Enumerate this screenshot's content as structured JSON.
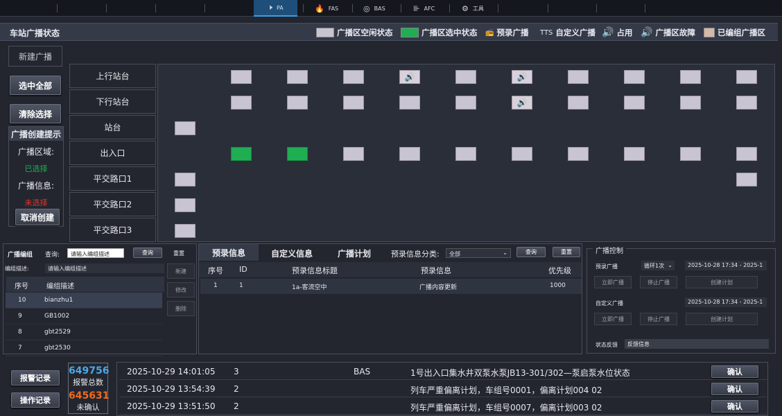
{
  "topnav": {
    "items": [
      {
        "label": "PA",
        "icon": "speaker-icon"
      },
      {
        "label": "FAS",
        "icon": "fire-icon"
      },
      {
        "label": "BAS",
        "icon": "fan-icon"
      },
      {
        "label": "AFC",
        "icon": "gate-icon"
      },
      {
        "label": "工具",
        "icon": "tools-icon"
      }
    ],
    "active": "PA"
  },
  "header": {
    "title": "车站广播状态",
    "legend": [
      "广播区空闲状态",
      "广播区选中状态",
      "预录广播",
      "TTS",
      "自定义广播",
      "占用",
      "广播区故障",
      "已编组广播区"
    ]
  },
  "colors": {
    "idle": "#c9c4d2",
    "selected": "#1fae52",
    "fault": "#e0352b",
    "occupied": "#f0d43a"
  },
  "left": {
    "new_broadcast": "新建广播",
    "select_all": "选中全部",
    "clear_selection": "清除选择",
    "hint_title": "广播创建提示",
    "area_label": "广播区域:",
    "area_status": "已选择",
    "info_label": "广播信息:",
    "info_status": "未选择",
    "cancel_create": "取消创建"
  },
  "rows": [
    "上行站台",
    "下行站台",
    "站台",
    "出入口",
    "平交路口1",
    "平交路口2",
    "平交路口3"
  ],
  "grid": {
    "layout": [
      [
        "e",
        "i",
        "i",
        "i",
        "f",
        "i",
        "f",
        "i",
        "i",
        "i",
        "i"
      ],
      [
        "e",
        "i",
        "i",
        "i",
        "i",
        "i",
        "f",
        "i",
        "i",
        "i",
        "i"
      ],
      [
        "i",
        "e",
        "e",
        "e",
        "e",
        "e",
        "e",
        "e",
        "e",
        "e",
        "e"
      ],
      [
        "e",
        "s",
        "s",
        "i",
        "i",
        "i",
        "i",
        "i",
        "i",
        "i",
        "i"
      ],
      [
        "i",
        "e",
        "e",
        "e",
        "e",
        "e",
        "e",
        "e",
        "e",
        "e",
        "i"
      ],
      [
        "i",
        "e",
        "e",
        "e",
        "e",
        "e",
        "e",
        "e",
        "e",
        "e",
        "e"
      ],
      [
        "i",
        "e",
        "e",
        "e",
        "e",
        "e",
        "e",
        "e",
        "e",
        "e",
        "e"
      ]
    ]
  },
  "group": {
    "title": "广播编组",
    "query_label": "查询:",
    "query_placeholder": "请输入编组描述",
    "query_btn": "查询",
    "reset_btn": "重置",
    "desc_label": "编组描述:",
    "desc_placeholder": "请输入编组描述",
    "col_no": "序号",
    "col_desc": "编组描述",
    "new": "新建",
    "edit": "修改",
    "delete": "删除",
    "rows": [
      {
        "no": "10",
        "desc": "bianzhu1"
      },
      {
        "no": "9",
        "desc": "GB1002"
      },
      {
        "no": "8",
        "desc": "gbt2529"
      },
      {
        "no": "7",
        "desc": "gbt2530"
      }
    ]
  },
  "prerecord": {
    "tabs": [
      "预录信息",
      "自定义信息",
      "广播计划"
    ],
    "category_label": "预录信息分类:",
    "category_value": "全部",
    "query_btn": "查询",
    "reset_btn": "重置",
    "columns": [
      "序号",
      "ID",
      "预录信息标题",
      "预录信息",
      "优先级"
    ],
    "rows": [
      {
        "no": "1",
        "id": "1",
        "title": "1a-客流空中",
        "info": "广播内容更新",
        "priority": "1000"
      }
    ]
  },
  "control": {
    "title": "广播控制",
    "prerecord_label": "预录广播",
    "loop": "循环1次",
    "time1": "2025-10-28 17:34 - 2025-1",
    "start": "立即广播",
    "stop": "停止广播",
    "plan": "创建计划",
    "custom_label": "自定义广播",
    "time2": "2025-10-28 17:34 - 2025-1",
    "feedback_label": "状态反馈",
    "feedback_value": "反馈信息"
  },
  "bottom": {
    "alarm_log": "报警记录",
    "op_log": "操作记录",
    "alarm_total": "649756",
    "alarm_total_label": "报警总数",
    "unconfirmed": "645631",
    "unconfirmed_label": "未确认",
    "confirm": "确认",
    "alarms": [
      {
        "time": "2025-10-29 14:01:05",
        "level": "3",
        "system": "BAS",
        "desc": "1号出入口集水井双泵水泵JB13-301/302—泵启泵水位状态"
      },
      {
        "time": "2025-10-29 13:54:39",
        "level": "2",
        "system": "",
        "desc": "列车严重偏离计划，车组号0001，偏离计划004  02"
      },
      {
        "time": "2025-10-29 13:51:50",
        "level": "2",
        "system": "",
        "desc": "列车严重偏离计划，车组号0007，偏离计划003  02"
      }
    ]
  }
}
